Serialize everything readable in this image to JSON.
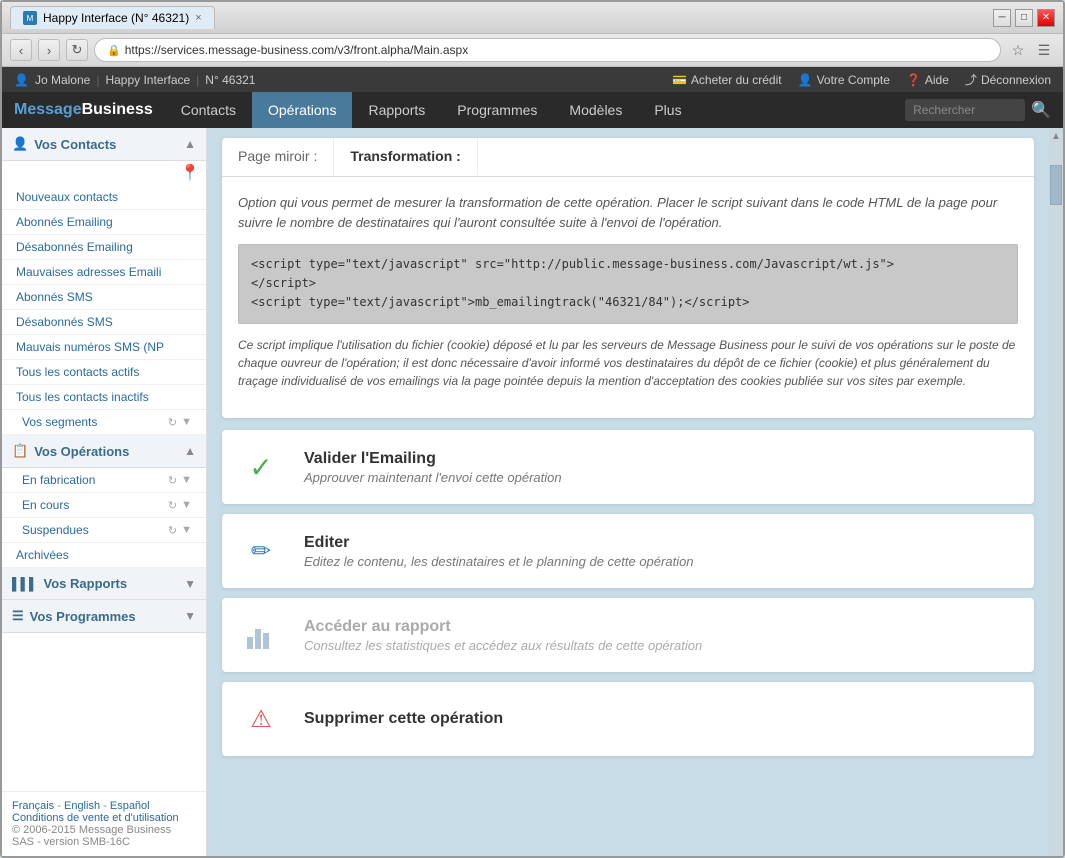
{
  "browser": {
    "title": "Happy Interface (N° 46321)",
    "url": "https://services.message-business.com/v3/front.alpha/Main.aspx",
    "tab_close": "×"
  },
  "topbar": {
    "user": "Jo Malone",
    "separator1": "|",
    "app_name": "Happy Interface",
    "separator2": "|",
    "account_num": "N° 46321",
    "buy_credit": "Acheter du crédit",
    "my_account": "Votre Compte",
    "help": "Aide",
    "logout": "Déconnexion"
  },
  "nav": {
    "logo": "MessageBusiness",
    "items": [
      {
        "label": "Contacts",
        "active": false
      },
      {
        "label": "Opérations",
        "active": true
      },
      {
        "label": "Rapports",
        "active": false
      },
      {
        "label": "Programmes",
        "active": false
      },
      {
        "label": "Modèles",
        "active": false
      },
      {
        "label": "Plus",
        "active": false
      }
    ],
    "search_placeholder": "Rechercher"
  },
  "sidebar": {
    "sections": [
      {
        "id": "contacts",
        "title": "Vos Contacts",
        "icon": "👤",
        "items": [
          {
            "label": "Nouveaux contacts",
            "sub": false
          },
          {
            "label": "Abonnés Emailing",
            "sub": false
          },
          {
            "label": "Désabonnés Emailing",
            "sub": false
          },
          {
            "label": "Mauvaises adresses Emaili",
            "sub": false
          },
          {
            "label": "Abonnés SMS",
            "sub": false
          },
          {
            "label": "Désabonnés SMS",
            "sub": false
          },
          {
            "label": "Mauvais numéros SMS (NP",
            "sub": false
          },
          {
            "label": "Tous les contacts actifs",
            "sub": false
          },
          {
            "label": "Tous les contacts inactifs",
            "sub": false
          },
          {
            "label": "Vos segments",
            "sub": true,
            "has_controls": true
          }
        ]
      },
      {
        "id": "operations",
        "title": "Vos Opérations",
        "icon": "📋",
        "items": [
          {
            "label": "En fabrication",
            "sub": true,
            "has_controls": true
          },
          {
            "label": "En cours",
            "sub": true,
            "has_controls": true
          },
          {
            "label": "Suspendues",
            "sub": true,
            "has_controls": true
          },
          {
            "label": "Archivées",
            "sub": false
          }
        ]
      },
      {
        "id": "rapports",
        "title": "Vos Rapports",
        "icon": "📊",
        "items": []
      },
      {
        "id": "programmes",
        "title": "Vos Programmes",
        "icon": "⚙",
        "items": []
      }
    ],
    "footer": {
      "lang_fr": "Français",
      "lang_en": "English",
      "lang_es": "Español",
      "conditions": "Conditions de vente et d'utilisation",
      "copyright": "© 2006-2015 Message Business SAS - version SMB-16C"
    }
  },
  "main": {
    "tabs": [
      {
        "label": "Page miroir :",
        "active": false
      },
      {
        "label": "Transformation :",
        "active": true
      }
    ],
    "description": "Option qui vous permet de mesurer la transformation de cette opération. Placer le script suivant dans le code HTML de la page pour suivre le nombre de destinataires qui l'auront consultée suite à l'envoi de l'opération.",
    "code_line1": "<script type=\"text/javascript\" src=\"http://public.message-business.com/Javascript/wt.js\">",
    "code_line2": "<\\/script>",
    "code_line3": "<script type=\"text/javascript\">mb_emailingtrack(\"46321/84\");<\\/script>",
    "note": "Ce script implique l'utilisation du fichier (cookie) déposé et lu par les serveurs de Message Business pour le suivi de vos opérations sur le poste de chaque ouvreur de l'opération; il est donc nécessaire d'avoir informé vos destinataires du dépôt de ce fichier (cookie) et plus généralement du traçage individualisé de vos emailings via la page pointée depuis la mention d'acceptation des cookies publiée sur vos sites par exemple.",
    "actions": [
      {
        "id": "validate",
        "icon": "✓",
        "icon_type": "green",
        "title": "Valider l'Emailing",
        "subtitle": "Approuver maintenant l'envoi cette opération",
        "disabled": false
      },
      {
        "id": "edit",
        "icon": "✏",
        "icon_type": "blue",
        "title": "Editer",
        "subtitle": "Editez le contenu, les destinataires et le planning de cette opération",
        "disabled": false
      },
      {
        "id": "report",
        "icon": "📊",
        "icon_type": "gray",
        "title": "Accéder au rapport",
        "subtitle": "Consultez les statistiques et accédez aux résultats de cette opération",
        "disabled": true
      },
      {
        "id": "delete",
        "icon": "⚠",
        "icon_type": "red",
        "title": "Supprimer cette opération",
        "subtitle": "",
        "disabled": false,
        "partial": true
      }
    ]
  }
}
